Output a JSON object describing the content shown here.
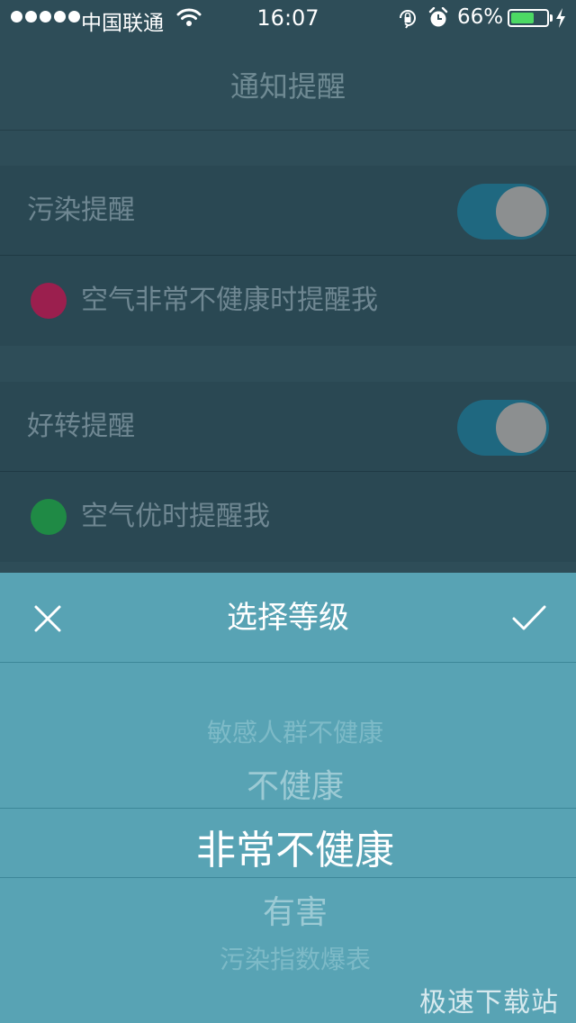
{
  "status_bar": {
    "carrier": "中国联通",
    "time": "16:07",
    "battery_percent": "66%",
    "battery_level": 0.66,
    "icons": [
      "signal-dots-icon",
      "wifi-icon",
      "rotation-lock-icon",
      "alarm-icon",
      "battery-icon",
      "charging-bolt-icon"
    ]
  },
  "nav": {
    "title": "通知提醒"
  },
  "pollution": {
    "label": "污染提醒",
    "enabled": true,
    "level_text": "空气非常不健康时提醒我",
    "level_color": "#9b1f4e"
  },
  "improvement": {
    "label": "好转提醒",
    "enabled": true,
    "level_text": "空气优时提醒我",
    "level_color": "#1f8a45"
  },
  "picker": {
    "title": "选择等级",
    "close_icon": "close-icon",
    "confirm_icon": "checkmark-icon",
    "options": [
      "敏感人群不健康",
      "不健康",
      "非常不健康",
      "有害",
      "污染指数爆表"
    ],
    "selected": "非常不健康"
  },
  "watermark": "极速下载站",
  "colors": {
    "background": "#2e4d58",
    "sheet": "#58a3b4",
    "toggle_track": "#1f6880",
    "battery_fill": "#4cd964"
  }
}
